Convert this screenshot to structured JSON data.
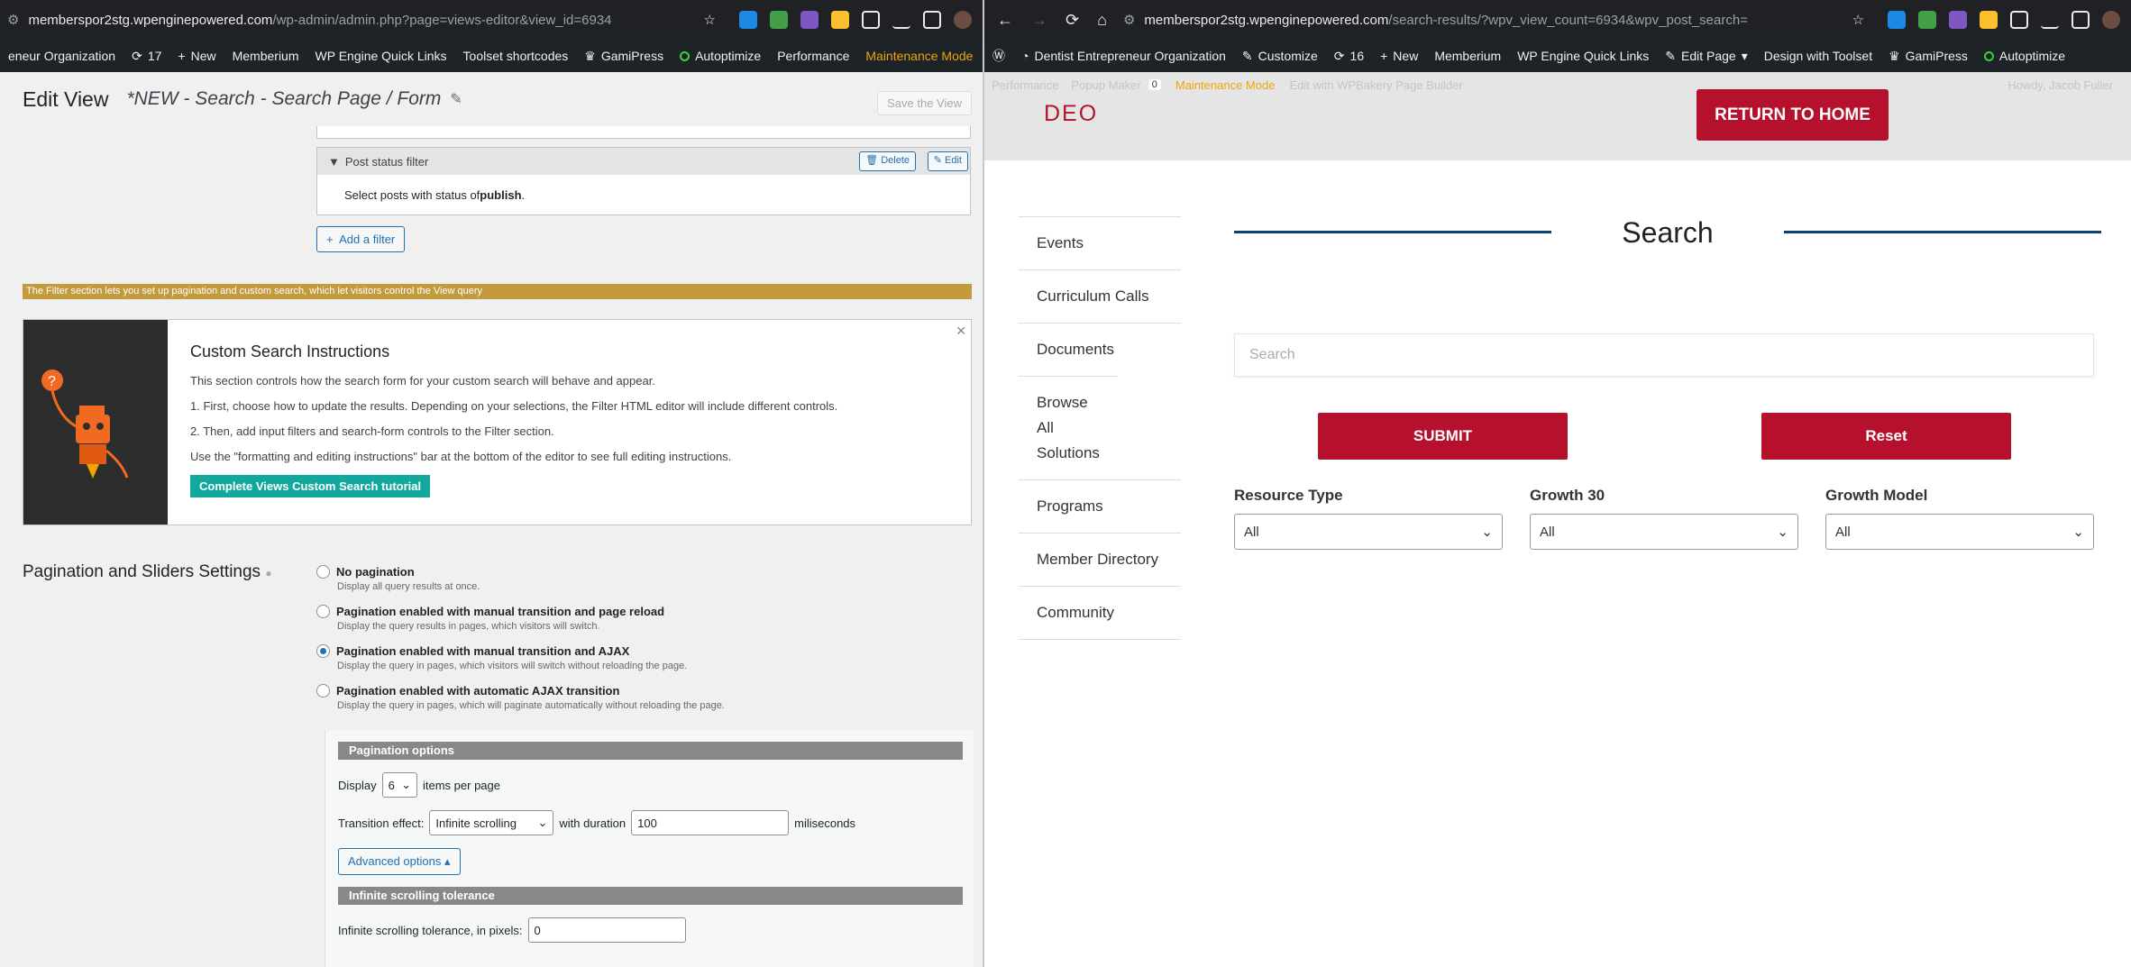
{
  "left": {
    "url_host": "memberspor2stg.wpenginepowered.com",
    "url_path": "/wp-admin/admin.php?page=views-editor&view_id=6934",
    "adminbar": [
      "eneur Organization",
      "17",
      "New",
      "Memberium",
      "WP Engine Quick Links",
      "Toolset shortcodes",
      "GamiPress",
      "Autoptimize",
      "Performance",
      "Maintenance Mode"
    ],
    "title": "Edit View",
    "view_name": "*NEW - Search - Search Page / Form",
    "save_label": "Save the View",
    "filter": {
      "header": "Post status filter",
      "delete": "Delete",
      "edit": "Edit",
      "body_pre": "Select posts with status of ",
      "body_bold": "publish",
      "body_post": "."
    },
    "add_filter": "Add a filter",
    "note": "The Filter section lets you set up pagination and custom search, which let visitors control the View query",
    "instructions": {
      "title": "Custom Search Instructions",
      "p1": "This section controls how the search form for your custom search will behave and appear.",
      "p2": "1. First, choose how to update the results. Depending on your selections, the Filter HTML editor will include different controls.",
      "p3": "2. Then, add input filters and search-form controls to the Filter section.",
      "p4": "Use the \"formatting and editing instructions\" bar at the bottom of the editor to see full editing instructions.",
      "tutorial": "Complete Views Custom Search tutorial"
    },
    "pagination_title": "Pagination and Sliders Settings",
    "radios": [
      {
        "label": "No pagination",
        "desc": "Display all query results at once.",
        "checked": false
      },
      {
        "label": "Pagination enabled with manual transition and page reload",
        "desc": "Display the query results in pages, which visitors will switch.",
        "checked": false
      },
      {
        "label": "Pagination enabled with manual transition and AJAX",
        "desc": "Display the query in pages, which visitors will switch without reloading the page.",
        "checked": true
      },
      {
        "label": "Pagination enabled with automatic AJAX transition",
        "desc": "Display the query in pages, which will paginate automatically without reloading the page.",
        "checked": false
      }
    ],
    "pagination_options": {
      "header": "Pagination options",
      "display_label": "Display",
      "display_value": "6",
      "per_page": "items per page",
      "transition_label": "Transition effect:",
      "transition_value": "Infinite scrolling",
      "duration_label": "with duration",
      "duration_value": "100",
      "duration_unit": "miliseconds",
      "advanced": "Advanced options",
      "tolerance_header": "Infinite scrolling tolerance",
      "tolerance_label": "Infinite scrolling tolerance, in pixels:",
      "tolerance_value": "0"
    }
  },
  "right": {
    "url_host": "memberspor2stg.wpenginepowered.com",
    "url_path": "/search-results/?wpv_view_count=6934&wpv_post_search=",
    "adminbar": [
      "Dentist Entrepreneur Organization",
      "Customize",
      "16",
      "New",
      "Memberium",
      "WP Engine Quick Links",
      "Edit Page",
      "Design with Toolset",
      "GamiPress",
      "Autoptimize"
    ],
    "adminbar2": [
      "Performance",
      "Popup Maker",
      "0",
      "Maintenance Mode",
      "Edit with WPBakery Page Builder",
      "Howdy, Jacob Fuller"
    ],
    "logo": "DEO",
    "return_home": "RETURN TO HOME",
    "sidebar": [
      "Events",
      "Curriculum Calls",
      "Documents",
      "Browse All Solutions",
      "Programs",
      "Member Directory",
      "Community"
    ],
    "search_title": "Search",
    "search_placeholder": "Search",
    "submit": "SUBMIT",
    "reset": "Reset",
    "filters": [
      {
        "label": "Resource Type",
        "value": "All"
      },
      {
        "label": "Growth 30",
        "value": "All"
      },
      {
        "label": "Growth Model",
        "value": "All"
      }
    ]
  },
  "colors": {
    "accent_red": "#b5112c",
    "wp_blue": "#2271b1",
    "navy_line": "#0f3d6e",
    "teal": "#13a89e"
  }
}
